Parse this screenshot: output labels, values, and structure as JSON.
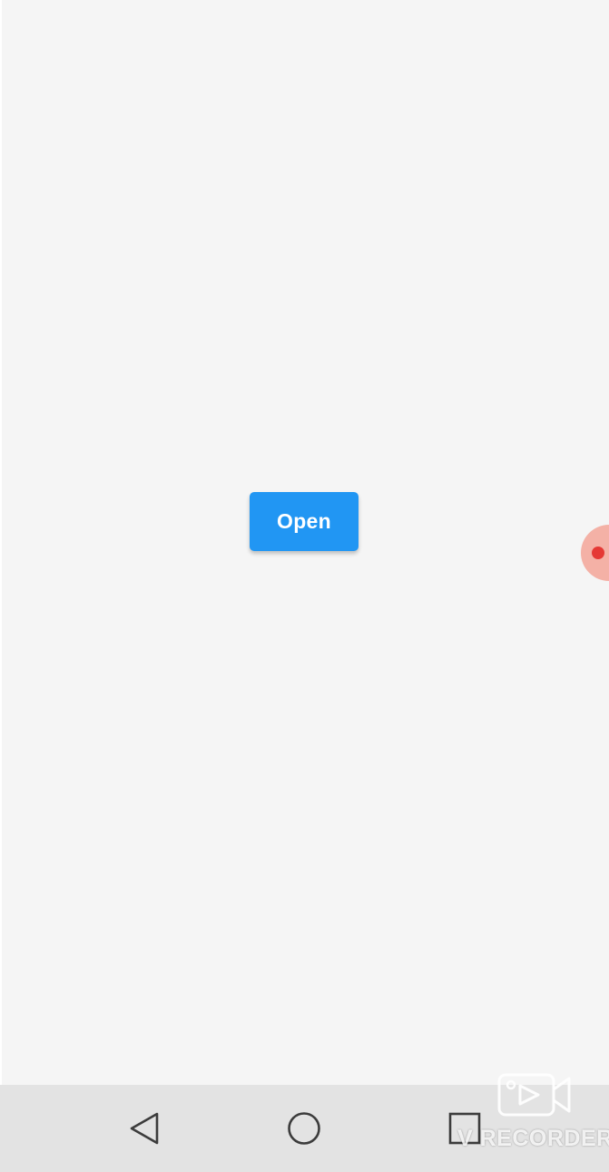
{
  "main": {
    "open_button_label": "Open"
  },
  "navigation_bar": {
    "buttons": [
      {
        "icon": "back-triangle-icon"
      },
      {
        "icon": "home-circle-icon"
      },
      {
        "icon": "recents-square-icon"
      }
    ]
  },
  "overlay": {
    "watermark_text": "V RECORDER",
    "watermark_icon": "video-play-icon",
    "floating_bubble_icon": "record-dot-icon"
  },
  "colors": {
    "background": "#f5f5f5",
    "button_blue": "#2196f3",
    "nav_bar": "#e3e3e3",
    "record_red": "#e53935"
  }
}
